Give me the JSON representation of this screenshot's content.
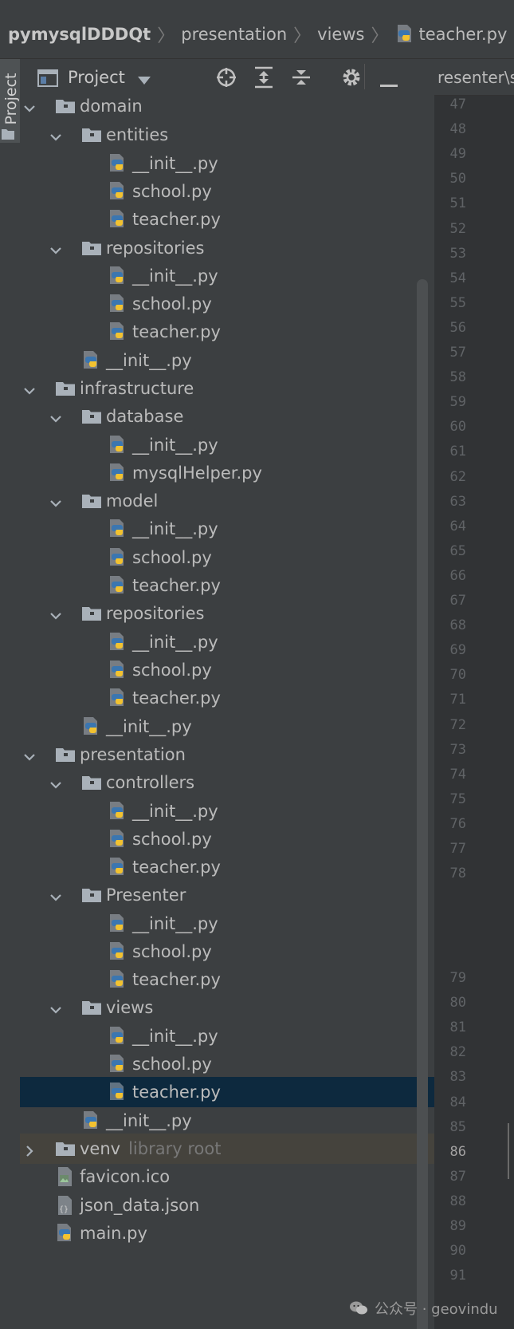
{
  "breadcrumb": {
    "project": "pymysqlDDDQt",
    "items": [
      "presentation",
      "views",
      "teacher.py"
    ]
  },
  "panel": {
    "title": "Project",
    "tool_window_label": "Project",
    "icons": [
      "locate-icon",
      "expand-all-icon",
      "collapse-all-icon",
      "gear-icon",
      "minimize-icon"
    ]
  },
  "editor": {
    "tab_label": "resenter\\s",
    "current_line": "86",
    "line_numbers": [
      "47",
      "48",
      "49",
      "50",
      "51",
      "52",
      "53",
      "54",
      "55",
      "56",
      "57",
      "58",
      "59",
      "60",
      "61",
      "62",
      "63",
      "64",
      "65",
      "66",
      "67",
      "68",
      "69",
      "70",
      "71",
      "72",
      "73",
      "74",
      "75",
      "76",
      "77",
      "78",
      "79",
      "80",
      "81",
      "82",
      "83",
      "84",
      "85",
      "86",
      "87",
      "88",
      "89",
      "90",
      "91"
    ]
  },
  "tree": [
    {
      "label": "domain",
      "type": "folder",
      "depth": 1,
      "expanded": true
    },
    {
      "label": "entities",
      "type": "folder",
      "depth": 2,
      "expanded": true
    },
    {
      "label": "__init__.py",
      "type": "py",
      "depth": 3
    },
    {
      "label": "school.py",
      "type": "py",
      "depth": 3
    },
    {
      "label": "teacher.py",
      "type": "py",
      "depth": 3
    },
    {
      "label": "repositories",
      "type": "folder",
      "depth": 2,
      "expanded": true
    },
    {
      "label": "__init__.py",
      "type": "py",
      "depth": 3
    },
    {
      "label": "school.py",
      "type": "py",
      "depth": 3
    },
    {
      "label": "teacher.py",
      "type": "py",
      "depth": 3
    },
    {
      "label": "__init__.py",
      "type": "py",
      "depth": 2
    },
    {
      "label": "infrastructure",
      "type": "folder",
      "depth": 1,
      "expanded": true
    },
    {
      "label": "database",
      "type": "folder",
      "depth": 2,
      "expanded": true
    },
    {
      "label": "__init__.py",
      "type": "py",
      "depth": 3
    },
    {
      "label": "mysqlHelper.py",
      "type": "py",
      "depth": 3
    },
    {
      "label": "model",
      "type": "folder",
      "depth": 2,
      "expanded": true
    },
    {
      "label": "__init__.py",
      "type": "py",
      "depth": 3
    },
    {
      "label": "school.py",
      "type": "py",
      "depth": 3
    },
    {
      "label": "teacher.py",
      "type": "py",
      "depth": 3
    },
    {
      "label": "repositories",
      "type": "folder",
      "depth": 2,
      "expanded": true
    },
    {
      "label": "__init__.py",
      "type": "py",
      "depth": 3
    },
    {
      "label": "school.py",
      "type": "py",
      "depth": 3
    },
    {
      "label": "teacher.py",
      "type": "py",
      "depth": 3
    },
    {
      "label": "__init__.py",
      "type": "py",
      "depth": 2
    },
    {
      "label": "presentation",
      "type": "folder",
      "depth": 1,
      "expanded": true
    },
    {
      "label": "controllers",
      "type": "folder",
      "depth": 2,
      "expanded": true
    },
    {
      "label": "__init__.py",
      "type": "py",
      "depth": 3
    },
    {
      "label": "school.py",
      "type": "py",
      "depth": 3
    },
    {
      "label": "teacher.py",
      "type": "py",
      "depth": 3
    },
    {
      "label": "Presenter",
      "type": "folder",
      "depth": 2,
      "expanded": true
    },
    {
      "label": "__init__.py",
      "type": "py",
      "depth": 3
    },
    {
      "label": "school.py",
      "type": "py",
      "depth": 3
    },
    {
      "label": "teacher.py",
      "type": "py",
      "depth": 3
    },
    {
      "label": "views",
      "type": "folder",
      "depth": 2,
      "expanded": true
    },
    {
      "label": "__init__.py",
      "type": "py",
      "depth": 3
    },
    {
      "label": "school.py",
      "type": "py",
      "depth": 3
    },
    {
      "label": "teacher.py",
      "type": "py",
      "depth": 3,
      "selected": true
    },
    {
      "label": "__init__.py",
      "type": "py",
      "depth": 2
    },
    {
      "label": "venv",
      "type": "folder",
      "depth": 1,
      "expanded": false,
      "suffix": "library root"
    },
    {
      "label": "favicon.ico",
      "type": "ico",
      "depth": 1
    },
    {
      "label": "json_data.json",
      "type": "json",
      "depth": 1
    },
    {
      "label": "main.py",
      "type": "py",
      "depth": 1
    }
  ],
  "watermark": "公众号 · geovindu",
  "colors": {
    "panel_bg": "#3c3f41",
    "selection": "#0d293e",
    "venv_row": "#45433d",
    "folder": "#a9b1b9",
    "python_blue": "#3b76b0",
    "python_yellow": "#f2c230"
  }
}
